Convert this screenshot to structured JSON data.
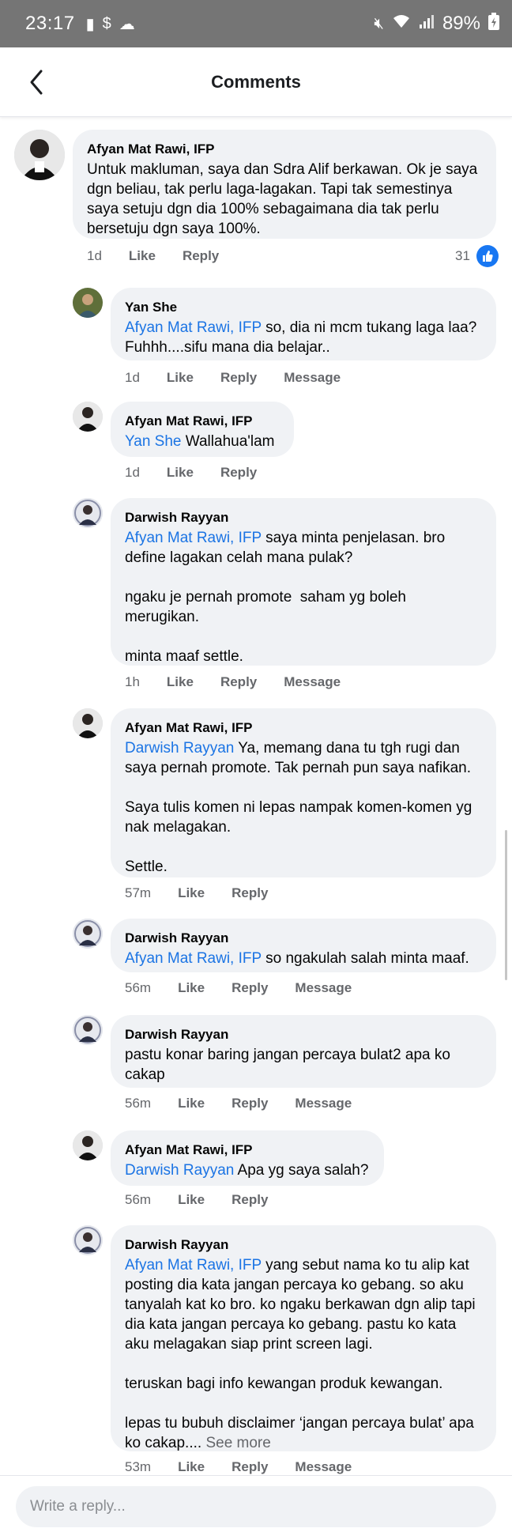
{
  "status_bar": {
    "time": "23:17",
    "battery": "89%",
    "icons": [
      "sd-card-icon",
      "dollar-icon",
      "cloud-icon",
      "mute-icon",
      "wifi-icon",
      "signal-icon",
      "battery-charging-icon"
    ]
  },
  "header": {
    "title": "Comments",
    "back_icon": "back-arrow-icon"
  },
  "comments": [
    {
      "author": "Afyan Mat Rawi, IFP",
      "mention": "",
      "text": "Untuk makluman, saya dan Sdra Alif berkawan. Ok je saya dgn beliau, tak perlu laga-lagakan. Tapi tak semestinya saya setuju dgn dia 100% sebagaimana dia tak perlu bersetuju dgn saya 100%.",
      "time": "1d",
      "like": "Like",
      "reply": "Reply",
      "likes": "31"
    },
    {
      "author": "Yan She",
      "mention": "Afyan Mat Rawi, IFP",
      "text": " so, dia ni mcm tukang laga laa? Fuhhh....sifu mana dia belajar..",
      "time": "1d",
      "like": "Like",
      "reply": "Reply",
      "message": "Message"
    },
    {
      "author": "Afyan Mat Rawi, IFP",
      "mention": "Yan She",
      "text": " Wallahua'lam",
      "time": "1d",
      "like": "Like",
      "reply": "Reply"
    },
    {
      "author": "Darwish Rayyan",
      "mention": "Afyan Mat Rawi, IFP",
      "text": " saya minta penjelasan. bro define lagakan celah mana pulak?\n\nngaku je pernah promote  saham yg boleh merugikan.\n\nminta maaf settle.",
      "time": "1h",
      "like": "Like",
      "reply": "Reply",
      "message": "Message"
    },
    {
      "author": "Afyan Mat Rawi, IFP",
      "mention": "Darwish Rayyan",
      "text": " Ya, memang dana tu tgh rugi dan saya pernah promote. Tak pernah pun saya nafikan.\n\nSaya tulis komen ni lepas nampak komen-komen yg nak melagakan.\n\nSettle.",
      "time": "57m",
      "like": "Like",
      "reply": "Reply"
    },
    {
      "author": "Darwish Rayyan",
      "mention": "Afyan Mat Rawi, IFP",
      "text": " so ngakulah salah minta maaf.",
      "time": "56m",
      "like": "Like",
      "reply": "Reply",
      "message": "Message"
    },
    {
      "author": "Darwish Rayyan",
      "mention": "",
      "text": "pastu konar baring jangan percaya bulat2 apa ko cakap",
      "time": "56m",
      "like": "Like",
      "reply": "Reply",
      "message": "Message"
    },
    {
      "author": "Afyan Mat Rawi, IFP",
      "mention": "Darwish Rayyan",
      "text": " Apa yg saya salah?",
      "time": "56m",
      "like": "Like",
      "reply": "Reply"
    },
    {
      "author": "Darwish Rayyan",
      "mention": "Afyan Mat Rawi, IFP",
      "text": " yang sebut nama ko tu alip kat posting dia kata jangan percaya ko gebang. so aku tanyalah kat ko bro. ko ngaku berkawan dgn alip tapi dia kata jangan percaya ko gebang. pastu ko kata aku melagakan siap print screen lagi.\n\nteruskan bagi info kewangan produk kewangan.\n\nlepas tu bubuh disclaimer ‘jangan percaya bulat’ apa ko cakap.... ",
      "see_more": "See more",
      "time": "53m",
      "like": "Like",
      "reply": "Reply",
      "message": "Message"
    }
  ],
  "reply_bar": {
    "placeholder": "Write a reply..."
  },
  "colors": {
    "mention": "#1b74e4",
    "bubble": "#f0f2f5",
    "meta": "#65676b",
    "like_badge": "#1877f2"
  }
}
